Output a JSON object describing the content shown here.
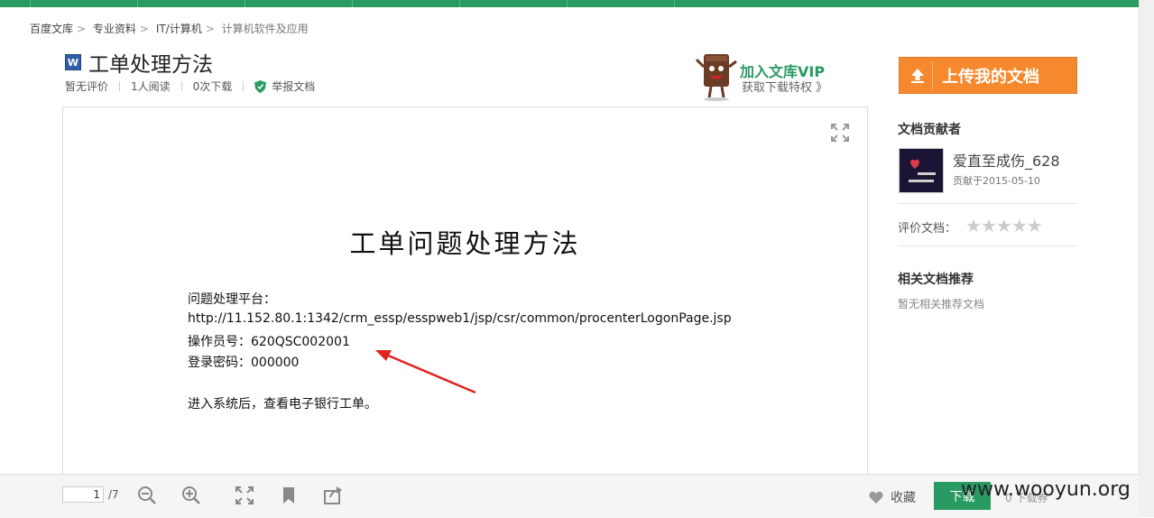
{
  "breadcrumb": [
    "百度文库",
    "专业资料",
    "IT/计算机",
    "计算机软件及应用"
  ],
  "document": {
    "type_icon": "W",
    "title": "工单处理方法",
    "meta": {
      "rating": "暂无评价",
      "reads": "1人阅读",
      "downloads": "0次下载",
      "report": "举报文档"
    }
  },
  "vip": {
    "title": "加入文库VIP",
    "subtitle": "获取下载特权 》"
  },
  "page": {
    "title": "工单问题处理方法",
    "lines": [
      "问题处理平台：",
      "http://11.152.80.1:1342/crm_essp/esspweb1/jsp/csr/common/procenterLogonPage.jsp",
      "操作员号：620QSC002001",
      "登录密码：000000",
      "进入系统后，查看电子银行工单。"
    ]
  },
  "toolbar": {
    "current_page": "1",
    "total_pages": "/7",
    "favorite": "收藏",
    "download": "下载",
    "coupon": "0 下载券"
  },
  "sidebar": {
    "upload": "上传我的文档",
    "contributor_heading": "文档贡献者",
    "contributor_name": "爱直至成伤_628",
    "contributor_date": "贡献于2015-05-10",
    "rate_label": "评价文档：",
    "related_heading": "相关文档推荐",
    "related_empty": "暂无相关推荐文档"
  },
  "watermark": "www.wooyun.org",
  "colors": {
    "brand_green": "#2a9a63",
    "upload_orange": "#f6892d",
    "arrow_red": "#e0231f"
  },
  "icons": [
    "word-doc-icon",
    "shield-icon",
    "vip-mascot-icon",
    "fullscreen-icon",
    "zoom-out-icon",
    "zoom-in-icon",
    "fit-icon",
    "bookmark-icon",
    "share-icon",
    "heart-icon",
    "upload-arrow-icon",
    "star-icon"
  ]
}
